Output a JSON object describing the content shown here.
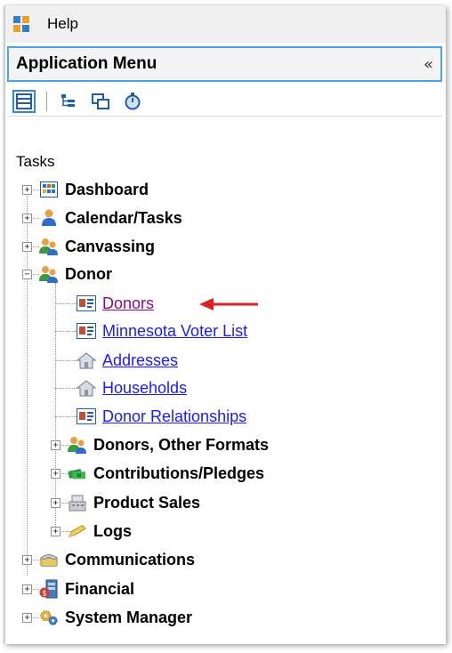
{
  "menubar": {
    "help_label": "Help"
  },
  "panel": {
    "title": "Application Menu",
    "collapse_glyph": "«"
  },
  "toolbar": {
    "buttons": [
      "list-view-icon",
      "tree-view-icon",
      "windows-icon",
      "stopwatch-icon"
    ]
  },
  "tasks_label": "Tasks",
  "tree": {
    "dashboard": "Dashboard",
    "calendar": "Calendar/Tasks",
    "canvassing": "Canvassing",
    "donor": "Donor",
    "donors": "Donors",
    "voter_list": "Minnesota Voter List",
    "addresses": "Addresses",
    "households": "Households",
    "donor_relationships": "Donor Relationships",
    "donors_other": "Donors, Other Formats",
    "contributions": "Contributions/Pledges",
    "product_sales": "Product Sales",
    "logs": "Logs",
    "communications": "Communications",
    "financial": "Financial",
    "system_manager": "System Manager"
  },
  "colors": {
    "accent": "#4aa3e8",
    "link": "#1a1aff",
    "visited": "#8b0a8b",
    "arrow": "#e02020"
  }
}
